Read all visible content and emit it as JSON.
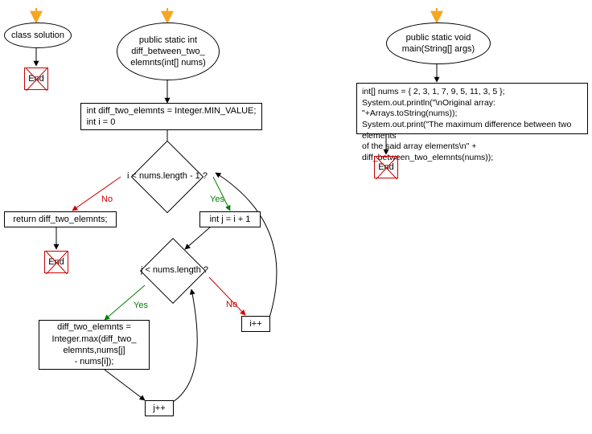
{
  "nodes": {
    "class_solution": "class solution",
    "method_diff": "public static int\ndiff_between_two_\nelemnts(int[] nums)",
    "method_main": "public static void\nmain(String[] args)",
    "init_block": "int diff_two_elemnts = Integer.MIN_VALUE;\nint i = 0",
    "outer_cond": "i < nums.length - 1 ?",
    "return_stmt": "return diff_two_elemnts;",
    "init_j": "int j = i + 1",
    "inner_cond": "j < nums.length ?",
    "update_diff": "diff_two_elemnts =\nInteger.max(diff_two_\nelemnts,nums[j]\n- nums[i]);",
    "inc_i": "i++",
    "inc_j": "j++",
    "main_body": "int[] nums = { 2, 3, 1, 7, 9, 5, 11, 3, 5 };\nSystem.out.println(\"\\nOriginal array: \"+Arrays.toString(nums));\nSystem.out.print(\"The maximum difference between two elements\nof the said array elements\\n\" + diff_between_two_elemnts(nums));",
    "end": "End",
    "yes": "Yes",
    "no": "No"
  },
  "chart_data": {
    "type": "flowchart",
    "language": "Java",
    "functions": [
      {
        "name": "class solution",
        "kind": "class-declaration",
        "body": []
      },
      {
        "name": "public static int diff_between_two_elemnts(int[] nums)",
        "kind": "method",
        "body": [
          {
            "id": "init",
            "type": "process",
            "text": "int diff_two_elemnts = Integer.MIN_VALUE; int i = 0"
          },
          {
            "id": "outer_cond",
            "type": "decision",
            "text": "i < nums.length - 1 ?",
            "no": [
              {
                "id": "return",
                "type": "process",
                "text": "return diff_two_elemnts;"
              },
              {
                "id": "end1",
                "type": "terminal",
                "text": "End"
              }
            ],
            "yes": [
              {
                "id": "init_j",
                "type": "process",
                "text": "int j = i + 1"
              },
              {
                "id": "inner_cond",
                "type": "decision",
                "text": "j < nums.length ?",
                "yes": [
                  {
                    "id": "update",
                    "type": "process",
                    "text": "diff_two_elemnts = Integer.max(diff_two_elemnts,nums[j] - nums[i]);"
                  },
                  {
                    "id": "jpp",
                    "type": "process",
                    "text": "j++",
                    "loop_back_to": "inner_cond"
                  }
                ],
                "no": [
                  {
                    "id": "ipp",
                    "type": "process",
                    "text": "i++",
                    "loop_back_to": "outer_cond"
                  }
                ]
              }
            ]
          }
        ]
      },
      {
        "name": "public static void main(String[] args)",
        "kind": "method",
        "body": [
          {
            "id": "main_body",
            "type": "process",
            "text": "int[] nums = { 2, 3, 1, 7, 9, 5, 11, 3, 5 }; System.out.println(\"\\nOriginal array: \"+Arrays.toString(nums)); System.out.print(\"The maximum difference between two elements of the said array elements\\n\" + diff_between_two_elemnts(nums));"
          },
          {
            "id": "end2",
            "type": "terminal",
            "text": "End"
          }
        ]
      }
    ]
  }
}
